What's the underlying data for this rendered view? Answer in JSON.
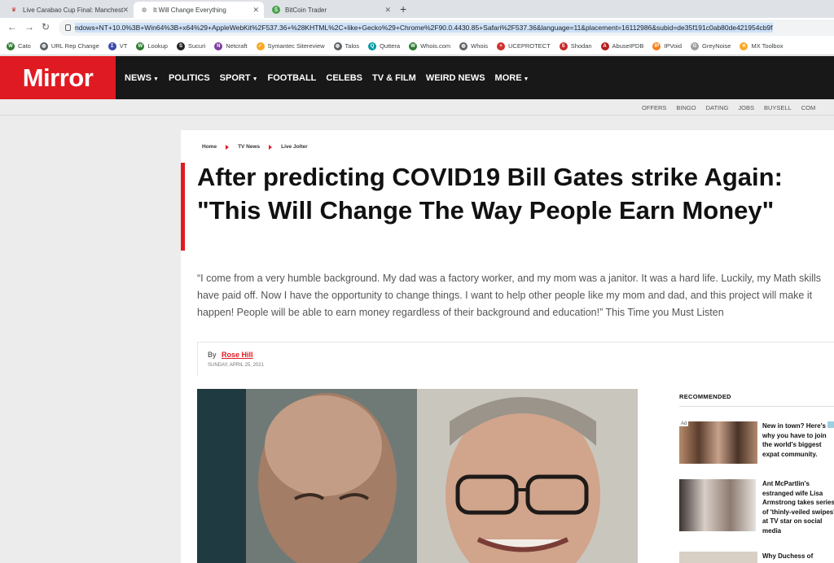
{
  "browser": {
    "tabs": [
      {
        "title": "Live Carabao Cup Final: Manchest",
        "active": false
      },
      {
        "title": "It Will Change Everything",
        "active": true
      },
      {
        "title": "BitCoin Trader",
        "active": false
      }
    ],
    "url": "ndows+NT+10.0%3B+Win64%3B+x64%29+AppleWebKit%2F537.36+%28KHTML%2C+like+Gecko%29+Chrome%2F90.0.4430.85+Safari%2F537.36&language=11&placement=16112986&subid=de35f191c0ab80de421954cb9f",
    "bookmarks": [
      {
        "label": "Cato",
        "icon": "cato-icon",
        "color": "#2e7d32",
        "glyph": "W"
      },
      {
        "label": "URL Rep Change",
        "icon": "globe-icon",
        "color": "#5f6368",
        "glyph": "◍"
      },
      {
        "label": "VT",
        "icon": "virustotal-icon",
        "color": "#3949ab",
        "glyph": "Σ"
      },
      {
        "label": "Lookup",
        "icon": "lookup-icon",
        "color": "#2e7d32",
        "glyph": "W"
      },
      {
        "label": "Sucuri",
        "icon": "sucuri-icon",
        "color": "#222222",
        "glyph": "S"
      },
      {
        "label": "Netcraft",
        "icon": "netcraft-icon",
        "color": "#7b3fa0",
        "glyph": "N"
      },
      {
        "label": "Symantec Sitereview",
        "icon": "symantec-icon",
        "color": "#f9a825",
        "glyph": "✓"
      },
      {
        "label": "Talos",
        "icon": "talos-icon",
        "color": "#5f6368",
        "glyph": "◍"
      },
      {
        "label": "Quttera",
        "icon": "quttera-icon",
        "color": "#0097a7",
        "glyph": "Q"
      },
      {
        "label": "Whois.com",
        "icon": "whois-com-icon",
        "color": "#2e7d32",
        "glyph": "W"
      },
      {
        "label": "Whois",
        "icon": "whois-icon",
        "color": "#5f6368",
        "glyph": "◍"
      },
      {
        "label": "UCEPROTECT",
        "icon": "uceprotect-icon",
        "color": "#d32f2f",
        "glyph": "+"
      },
      {
        "label": "Shodan",
        "icon": "shodan-icon",
        "color": "#c62828",
        "glyph": "S"
      },
      {
        "label": "AbuseIPDB",
        "icon": "abuseipdb-icon",
        "color": "#b71c1c",
        "glyph": "A"
      },
      {
        "label": "IPVoid",
        "icon": "ipvoid-icon",
        "color": "#f57f17",
        "glyph": "IP"
      },
      {
        "label": "GreyNoise",
        "icon": "greynoise-icon",
        "color": "#9e9e9e",
        "glyph": "G"
      },
      {
        "label": "MX Toolbox",
        "icon": "mxtoolbox-icon",
        "color": "#f9a825",
        "glyph": "✕"
      }
    ]
  },
  "site": {
    "logo": "Mirror",
    "brand_color": "#e01a22",
    "nav": [
      {
        "label": "NEWS",
        "dropdown": true
      },
      {
        "label": "POLITICS",
        "dropdown": false
      },
      {
        "label": "SPORT",
        "dropdown": true
      },
      {
        "label": "FOOTBALL",
        "dropdown": false
      },
      {
        "label": "CELEBS",
        "dropdown": false
      },
      {
        "label": "TV & FILM",
        "dropdown": false
      },
      {
        "label": "WEIRD NEWS",
        "dropdown": false
      },
      {
        "label": "MORE",
        "dropdown": true
      }
    ],
    "subnav": [
      "OFFERS",
      "BINGO",
      "DATING",
      "JOBS",
      "BUYSELL",
      "COM"
    ]
  },
  "article": {
    "breadcrumb": [
      "Home",
      "TV News",
      "Live Jolter"
    ],
    "headline": "After predicting COVID19 Bill Gates strike Again: \"This Will Change The Way People Earn Money\"",
    "standfirst": "“I come from a very humble background. My dad was a factory worker, and my mom was a janitor. It was a hard life. Luckily, my Math skills have paid off. Now I have the opportunity to change things. I want to help other people like my mom and dad, and this project will make it happen! People will be able to earn money regardless of their background and education!” This Time you Must Listen",
    "by_label": "By",
    "author": "Rose Hill",
    "date": "SUNDAY, APRIL 25, 2021"
  },
  "sidebar": {
    "title": "RECOMMENDED",
    "ad_label": "Ad",
    "items": [
      {
        "text": "New in town? Here's why you have to join the world's biggest expat community."
      },
      {
        "text": "Ant McPartlin's estranged wife Lisa Armstrong takes series of 'thinly-veiled swipes' at TV star on social media"
      },
      {
        "text": "Why Duchess of"
      }
    ]
  }
}
